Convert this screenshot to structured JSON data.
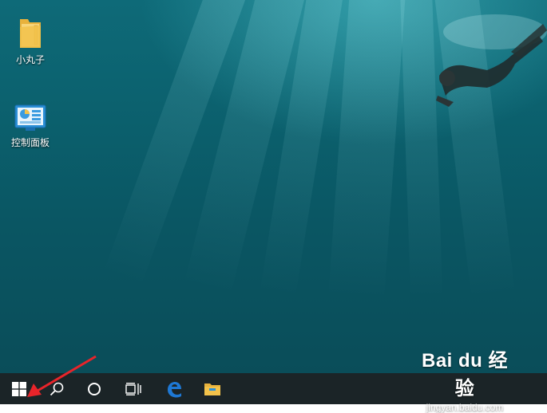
{
  "desktop": {
    "icons": [
      {
        "label": "小丸子",
        "icon": "folder-icon"
      },
      {
        "label": "控制面板",
        "icon": "control-panel-icon"
      }
    ]
  },
  "taskbar": {
    "buttons": [
      {
        "icon": "windows-start-icon"
      },
      {
        "icon": "search-icon"
      },
      {
        "icon": "cortana-icon"
      },
      {
        "icon": "task-view-icon"
      },
      {
        "icon": "edge-browser-icon"
      },
      {
        "icon": "file-explorer-icon"
      }
    ],
    "background": "#1b2427"
  },
  "watermark": {
    "brand": "Bai du 经验",
    "url": "jingyan.baidu.com"
  },
  "colors": {
    "water": "#0b5f6c",
    "arrow": "#e8242a",
    "edge_blue": "#1e78d4",
    "folder_yellow": "#f2c24b"
  }
}
